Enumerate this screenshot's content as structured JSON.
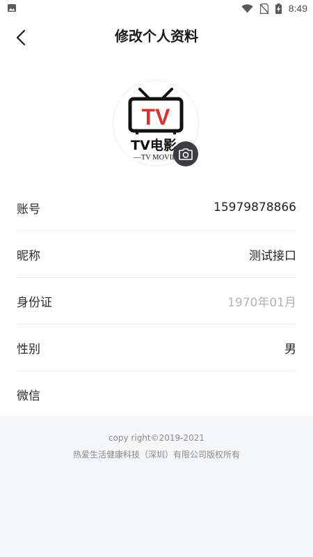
{
  "status_bar": {
    "time": "8:49",
    "icons": [
      "gallery-icon",
      "wifi-icon",
      "no-sim-icon",
      "battery-charging-icon"
    ]
  },
  "header": {
    "title": "修改个人资料",
    "back_icon": "chevron-left-icon"
  },
  "avatar": {
    "logo_mark": "TV",
    "logo_text": "TV电影",
    "logo_subtext": "—TV MOVIE",
    "camera_icon": "camera-icon",
    "brand_red": "#d9332b"
  },
  "profile": {
    "rows": [
      {
        "label": "账号",
        "value": "15979878866"
      },
      {
        "label": "昵称",
        "value": "测试接口"
      },
      {
        "label": "身份证",
        "value": "1970年01月"
      },
      {
        "label": "性别",
        "value": "男"
      },
      {
        "label": "微信",
        "value": ""
      }
    ]
  },
  "footer": {
    "copyright": "copy right©2019-2021",
    "company": "热爱生活健康科技（深圳）有限公司版权所有"
  }
}
